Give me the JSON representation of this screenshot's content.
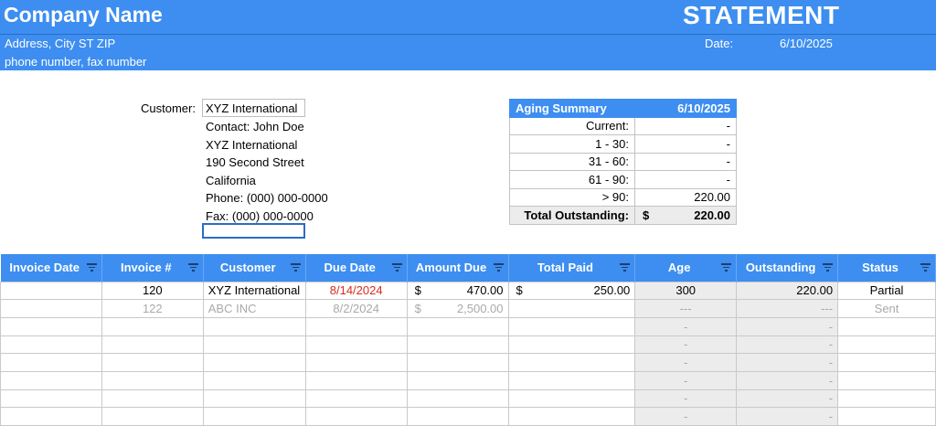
{
  "header": {
    "company_name": "Company Name",
    "title": "STATEMENT",
    "address": "Address, City ST ZIP",
    "phone": "phone number, fax number",
    "date_label": "Date:",
    "date_value": "6/10/2025"
  },
  "customer": {
    "label": "Customer:",
    "value": "XYZ International",
    "lines": [
      "Contact: John Doe",
      "XYZ International",
      "190 Second Street",
      "California",
      "Phone: (000) 000-0000",
      "Fax: (000) 000-0000"
    ]
  },
  "aging": {
    "title": "Aging Summary",
    "date": "6/10/2025",
    "rows": [
      {
        "label": "Current:",
        "value": "-"
      },
      {
        "label": "1 - 30:",
        "value": "-"
      },
      {
        "label": "31 - 60:",
        "value": "-"
      },
      {
        "label": "61 - 90:",
        "value": "-"
      },
      {
        "label": "> 90:",
        "value": "220.00"
      }
    ],
    "total_label": "Total Outstanding:",
    "total_currency": "$",
    "total_value": "220.00"
  },
  "table": {
    "columns": [
      "Invoice Date",
      "Invoice #",
      "Customer",
      "Due Date",
      "Amount Due",
      "Total Paid",
      "Age",
      "Outstanding",
      "Status"
    ],
    "rows": [
      {
        "invoice_date": "",
        "invoice_no": "120",
        "customer": "XYZ International",
        "due_date": "8/14/2024",
        "amount_sym": "$",
        "amount": "470.00",
        "paid_sym": "$",
        "paid": "250.00",
        "age": "300",
        "outstanding": "220.00",
        "status": "Partial"
      },
      {
        "invoice_date": "",
        "invoice_no": "122",
        "customer": "ABC INC",
        "due_date": "8/2/2024",
        "amount_sym": "$",
        "amount": "2,500.00",
        "paid_sym": "",
        "paid": "",
        "age": "---",
        "outstanding": "---",
        "status": "Sent"
      },
      {
        "age": "-",
        "outstanding": "-"
      },
      {
        "age": "-",
        "outstanding": "-"
      },
      {
        "age": "-",
        "outstanding": "-"
      },
      {
        "age": "-",
        "outstanding": "-"
      },
      {
        "age": "-",
        "outstanding": "-"
      },
      {
        "age": "-",
        "outstanding": "-"
      }
    ]
  }
}
